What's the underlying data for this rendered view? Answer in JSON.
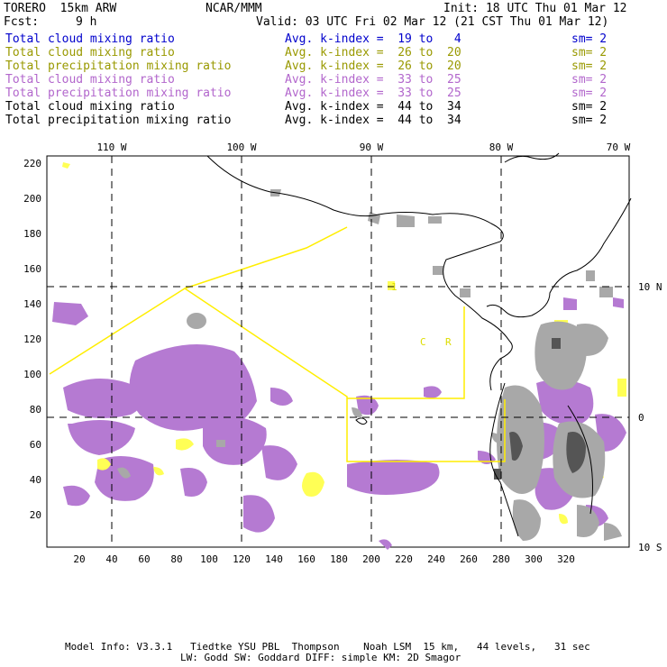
{
  "header": {
    "model": "TORERO  15km ARW",
    "org": "NCAR/MMM",
    "init": "Init: 18 UTC Thu 01 Mar 12",
    "fcst_label": "Fcst:",
    "fcst_value": "9 h",
    "valid": "Valid: 03 UTC Fri 02 Mar 12 (21 CST Thu 01 Mar 12)"
  },
  "legend": [
    {
      "field": "Total cloud mixing ratio",
      "kindex": "Avg. k-index =  19 to   4",
      "sm": "sm= 2",
      "color": "#0000cc"
    },
    {
      "field": "Total cloud mixing ratio",
      "kindex": "Avg. k-index =  26 to  20",
      "sm": "sm= 2",
      "color": "#999900"
    },
    {
      "field": "Total precipitation mixing ratio",
      "kindex": "Avg. k-index =  26 to  20",
      "sm": "sm= 2",
      "color": "#999900"
    },
    {
      "field": "Total cloud mixing ratio",
      "kindex": "Avg. k-index =  33 to  25",
      "sm": "sm= 2",
      "color": "#b266cc"
    },
    {
      "field": "Total precipitation mixing ratio",
      "kindex": "Avg. k-index =  33 to  25",
      "sm": "sm= 2",
      "color": "#b266cc"
    },
    {
      "field": "Total cloud mixing ratio",
      "kindex": "Avg. k-index =  44 to  34",
      "sm": "sm= 2",
      "color": "#000000"
    },
    {
      "field": "Total precipitation mixing ratio",
      "kindex": "Avg. k-index =  44 to  34",
      "sm": "sm= 2",
      "color": "#000000"
    }
  ],
  "map": {
    "longitude_labels": [
      "110 W",
      "100 W",
      "90 W",
      "80 W",
      "70 W"
    ],
    "latitude_labels": [
      "10 N",
      "0",
      "10 S"
    ],
    "y_ticks": [
      "220",
      "200",
      "180",
      "160",
      "140",
      "120",
      "100",
      "80",
      "60",
      "40",
      "20"
    ],
    "x_ticks": [
      "20",
      "40",
      "60",
      "80",
      "100",
      "120",
      "140",
      "160",
      "180",
      "200",
      "220",
      "240",
      "260",
      "280",
      "300",
      "320"
    ],
    "annotations": [
      {
        "text": "C",
        "color": "#dddd00"
      },
      {
        "text": "R",
        "color": "#dddd00"
      },
      {
        "text": "1",
        "color": "#dddd00"
      }
    ],
    "colors": {
      "cloud_purple": "#b57ad2",
      "yellow": "#ffff55",
      "gray": "#a8a8a8",
      "dark_gray": "#555555",
      "box_line": "#ffee00"
    }
  },
  "footer": {
    "line1": "Model Info: V3.3.1   Tiedtke YSU PBL  Thompson    Noah LSM  15 km,   44 levels,   31 sec",
    "line2": "LW: Godd SW: Goddard DIFF: simple KM: 2D Smagor"
  }
}
